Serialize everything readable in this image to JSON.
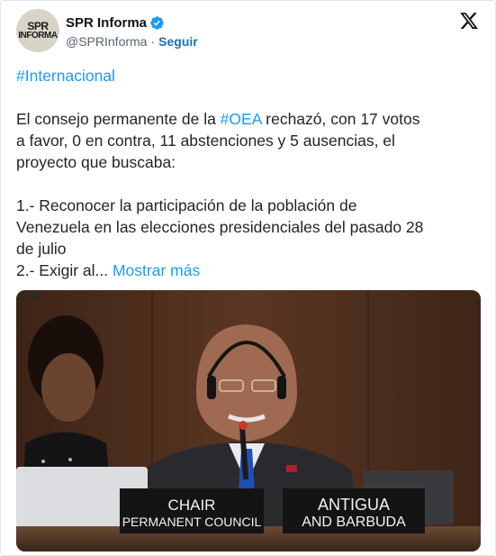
{
  "author": {
    "display_name": "SPR Informa",
    "handle": "@SPRInforma",
    "separator": "·",
    "follow_label": "Seguir",
    "avatar_text_line1": "SPR",
    "avatar_text_line2": "INFORMA",
    "verified_icon": "verified-badge-icon"
  },
  "platform": {
    "logo_icon": "x-logo-icon"
  },
  "tweet": {
    "line1": "#Internacional",
    "line2_pre": "El consejo permanente de la ",
    "line2_tag": "#OEA",
    "line2_post": " rechazó, con 17 votos",
    "line3": "a favor, 0 en contra, 11 abstenciones y 5 ausencias, el",
    "line4": "proyecto que buscaba:",
    "line5": "1.- Reconocer la participación de la población de",
    "line6": "Venezuela en las elecciones presidenciales del pasado 28",
    "line7": "de julio",
    "line8_pre": "2.- Exigir al... ",
    "show_more": "Mostrar más"
  },
  "media": {
    "badge_text": "•",
    "plate_left_line1": "CHAIR",
    "plate_left_line2": "PERMANENT COUNCIL",
    "plate_right_line1": "ANTIGUA",
    "plate_right_line2": "AND BARBUDA"
  },
  "colors": {
    "link": "#1d9bf0",
    "follow": "#1d6fb8",
    "verified": "#1d9bf0",
    "text": "#0f1419",
    "secondary": "#536471",
    "wood": "#4a2c1c"
  }
}
